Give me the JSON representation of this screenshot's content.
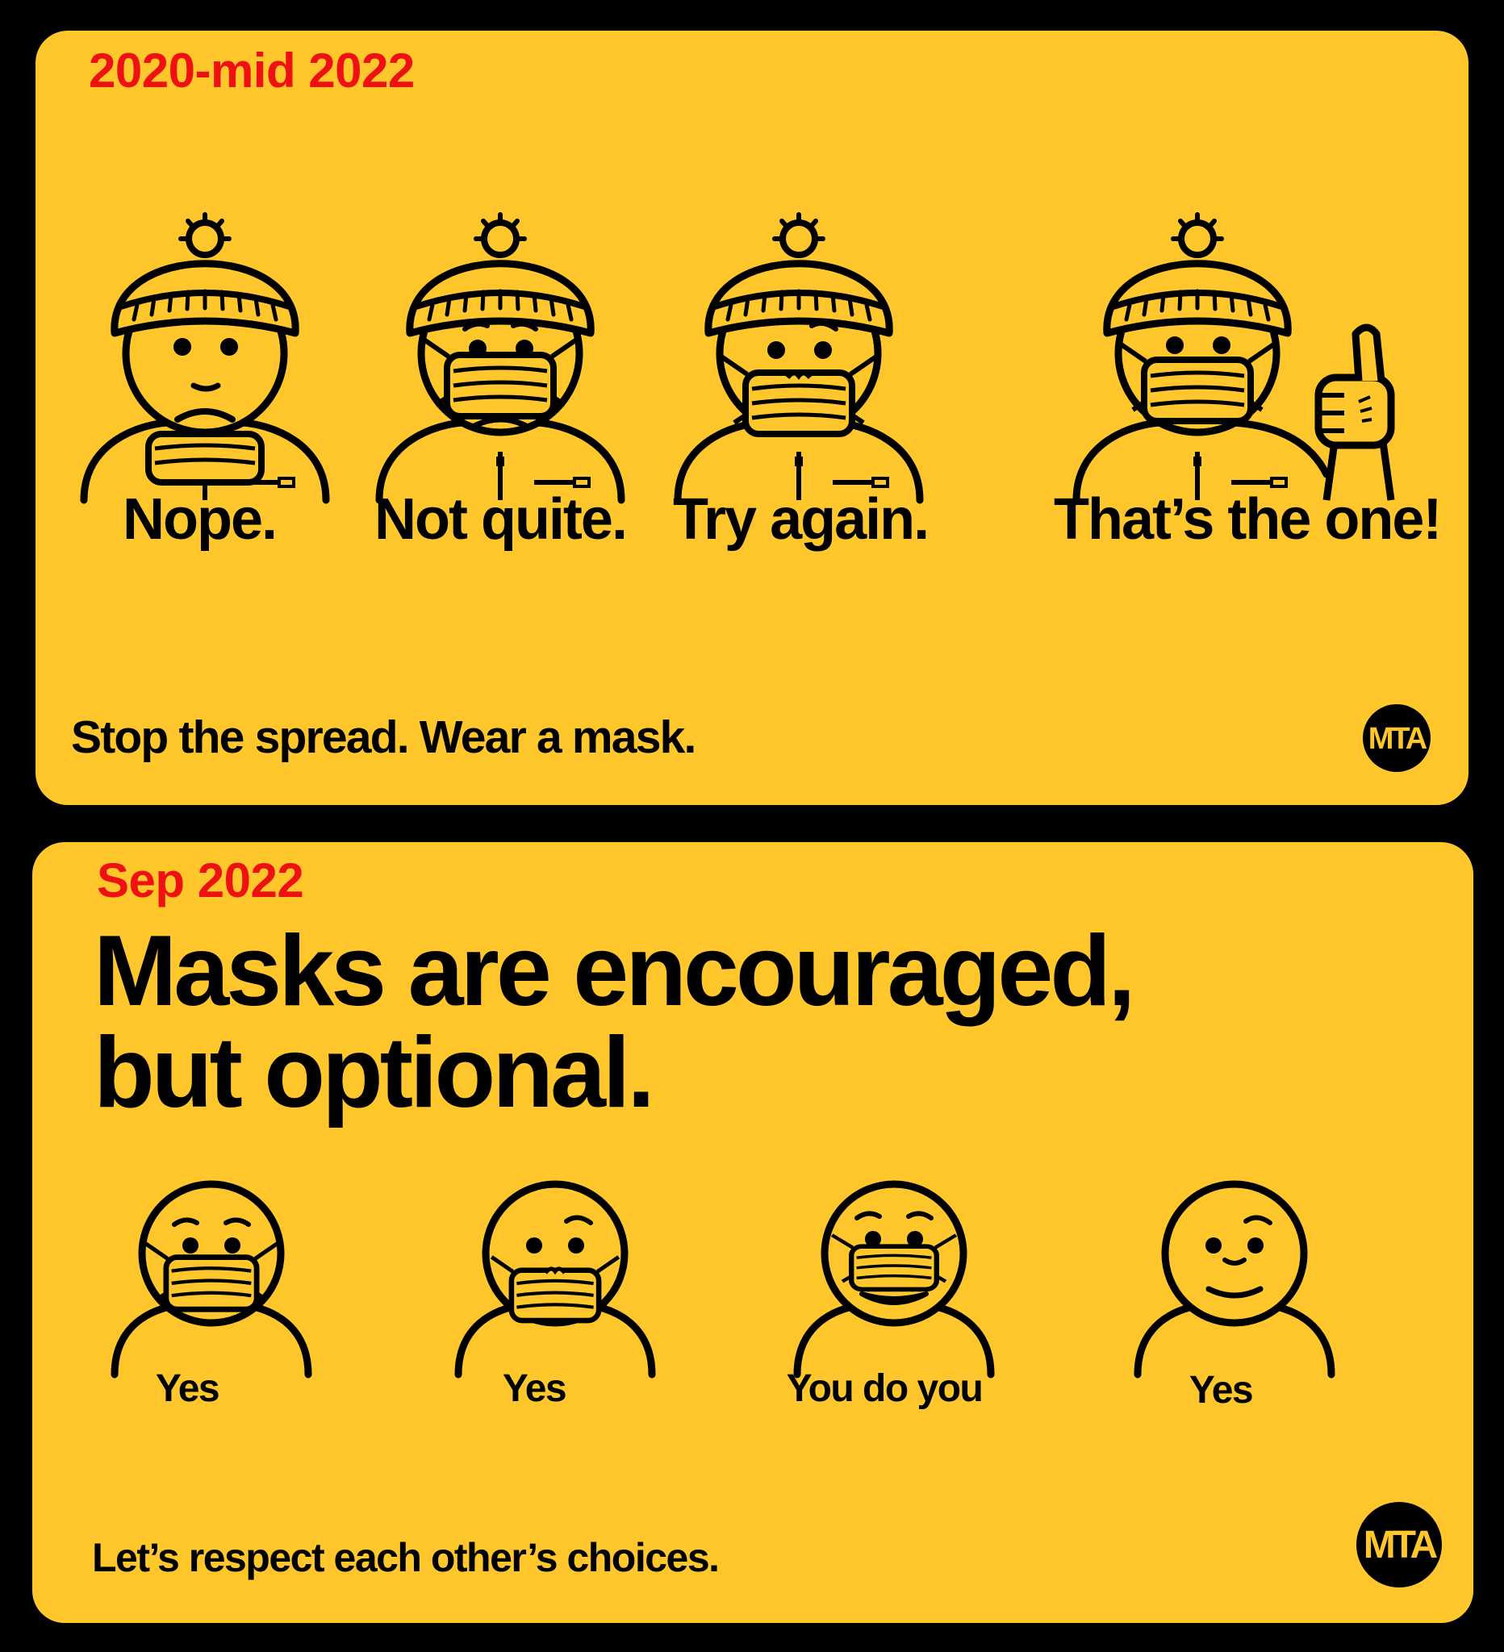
{
  "colors": {
    "background": "#000000",
    "panel": "#FFC72C",
    "accent_red": "#EE1111",
    "ink": "#000000"
  },
  "top_panel": {
    "period": "2020-mid 2022",
    "figures": [
      {
        "caption": "Nope.",
        "icon": "beanie-person-mask-on-chin-frowning-icon"
      },
      {
        "caption": "Not quite.",
        "icon": "beanie-person-mask-below-nose-icon"
      },
      {
        "caption": "Try again.",
        "icon": "beanie-person-mask-below-nose-smirk-icon"
      },
      {
        "caption": "That’s the one!",
        "icon": "beanie-person-mask-on-thumbs-up-icon"
      }
    ],
    "tagline": "Stop the spread. Wear a mask.",
    "logo": "MTA"
  },
  "bottom_panel": {
    "period": "Sep 2022",
    "headline_line1": "Masks are encouraged,",
    "headline_line2": "but optional.",
    "figures": [
      {
        "caption": "Yes",
        "icon": "person-masked-icon"
      },
      {
        "caption": "Yes",
        "icon": "person-mask-below-nose-icon"
      },
      {
        "caption": "You do you",
        "icon": "person-mask-with-mouth-showing-icon"
      },
      {
        "caption": "Yes",
        "icon": "person-unmasked-smiling-icon"
      }
    ],
    "tagline": "Let’s respect each other’s choices.",
    "logo": "MTA"
  }
}
